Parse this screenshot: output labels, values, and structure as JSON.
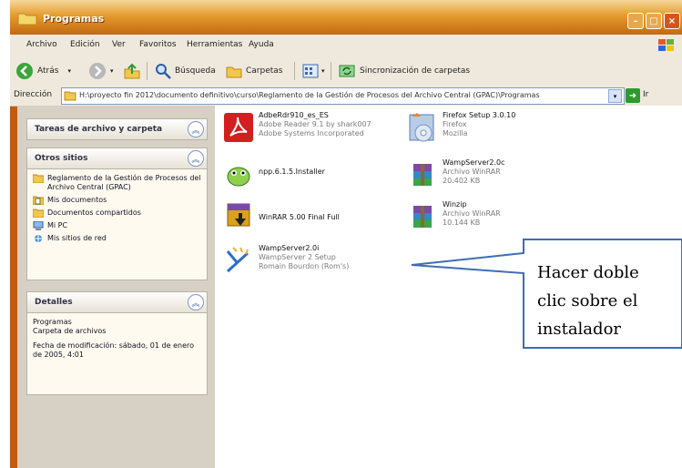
{
  "window": {
    "title": "Programas",
    "buttons": [
      "minimize-icon",
      "maximize-icon",
      "close-icon"
    ]
  },
  "menubar": [
    "Archivo",
    "Edición",
    "Ver",
    "Favoritos",
    "Herramientas",
    "Ayuda"
  ],
  "toolbar": {
    "back": "Atrás",
    "search": "Búsqueda",
    "folders": "Carpetas",
    "sync": "Sincronización de carpetas"
  },
  "address": {
    "label": "Dirección",
    "value": "H:\\proyecto fin 2012\\documento definitivo\\curso\\Reglamento de la Gestión de Procesos del Archivo Central (GPAC)\\Programas",
    "go": "Ir"
  },
  "sidebar": {
    "tasks": {
      "title": "Tareas de archivo y carpeta"
    },
    "places": {
      "title": "Otros sitios",
      "items": [
        "Reglamento de la Gestión de Procesos del Archivo Central (GPAC)",
        "Mis documentos",
        "Documentos compartidos",
        "Mi PC",
        "Mis sitios de red"
      ]
    },
    "details": {
      "title": "Detalles",
      "name": "Programas",
      "type": "Carpeta de archivos",
      "modified": "Fecha de modificación: sábado, 01 de enero de 2005, 4:01"
    }
  },
  "files": [
    {
      "name": "AdbeRdr910_es_ES",
      "line2": "Adobe Reader 9.1 by shark007",
      "line3": "Adobe Systems Incorporated",
      "icon": "adobe-reader-icon"
    },
    {
      "name": "Firefox Setup 3.0.10",
      "line2": "Firefox",
      "line3": "Mozilla",
      "icon": "firefox-setup-icon"
    },
    {
      "name": "npp.6.1.5.Installer",
      "line2": "",
      "line3": "",
      "icon": "notepad-plus-icon"
    },
    {
      "name": "WampServer2.0c",
      "line2": "Archivo WinRAR",
      "line3": "20.402 KB",
      "icon": "winrar-archive-icon"
    },
    {
      "name": "WinRAR 5.00 Final Full",
      "line2": "",
      "line3": "",
      "icon": "winrar-installer-icon"
    },
    {
      "name": "Winzip",
      "line2": "Archivo WinRAR",
      "line3": "10.144 KB",
      "icon": "winrar-archive-icon"
    },
    {
      "name": "WampServer2.0i",
      "line2": "WampServer 2 Setup",
      "line3": "Romain Bourdon (Rom's)",
      "icon": "wampserver-icon"
    }
  ],
  "callout": {
    "lines": [
      "Hacer doble",
      "clic sobre el",
      "instalador"
    ],
    "border": "#3d6db5"
  }
}
